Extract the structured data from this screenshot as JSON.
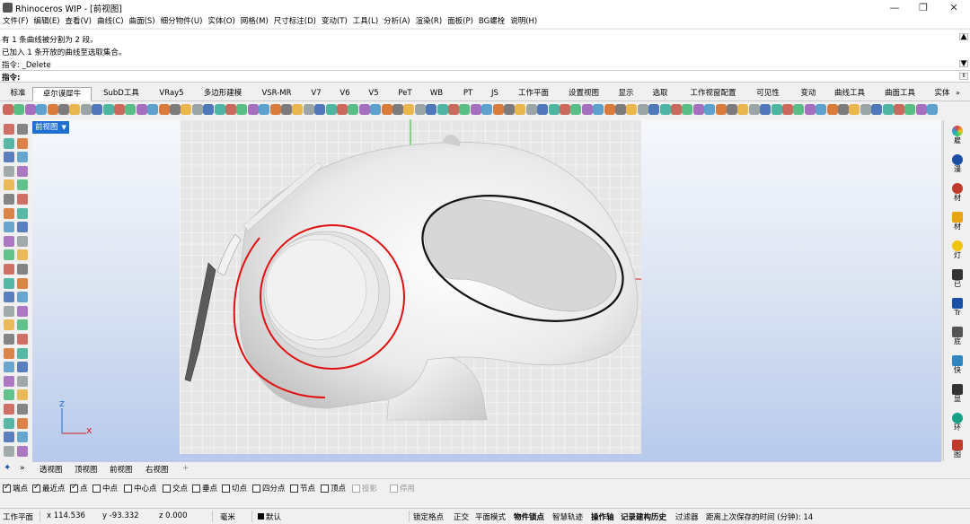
{
  "window": {
    "title": "Rhinoceros WIP - [前视图]",
    "minimize": "—",
    "maximize": "❐",
    "close": "✕"
  },
  "menu": [
    "文件(F)",
    "编辑(E)",
    "查看(V)",
    "曲线(C)",
    "曲面(S)",
    "细分物件(U)",
    "实体(O)",
    "网格(M)",
    "尺寸标注(D)",
    "变动(T)",
    "工具(L)",
    "分析(A)",
    "渲染(R)",
    "面板(P)",
    "BG螺栓",
    "说明(H)"
  ],
  "history": [
    "有 1 条曲线被分割为 2 段。",
    "已加入 1 条开放的曲线至选取集合。",
    "指令: _Delete"
  ],
  "command": {
    "label": "指令:",
    "value": ""
  },
  "tabs": [
    {
      "label": "标准",
      "active": false
    },
    {
      "label": "卓尔谟犀牛",
      "active": true
    },
    {
      "label": "SubD工具",
      "active": false
    },
    {
      "label": "VRay5",
      "active": false
    },
    {
      "label": "多边形建模",
      "active": false
    },
    {
      "label": "VSR-MR",
      "active": false
    },
    {
      "label": "V7",
      "active": false
    },
    {
      "label": "V6",
      "active": false
    },
    {
      "label": "V5",
      "active": false
    },
    {
      "label": "PeT",
      "active": false
    },
    {
      "label": "WB",
      "active": false
    },
    {
      "label": "PT",
      "active": false
    },
    {
      "label": "JS",
      "active": false
    },
    {
      "label": "工作平面",
      "active": false
    },
    {
      "label": "设置视图",
      "active": false
    },
    {
      "label": "显示",
      "active": false
    },
    {
      "label": "选取",
      "active": false
    },
    {
      "label": "工作视窗配置",
      "active": false
    },
    {
      "label": "可见性",
      "active": false
    },
    {
      "label": "变动",
      "active": false
    },
    {
      "label": "曲线工具",
      "active": false
    },
    {
      "label": "曲面工具",
      "active": false
    },
    {
      "label": "实体",
      "active": false
    }
  ],
  "viewport": {
    "name": "前视图",
    "axis_x": "x",
    "axis_z": "z"
  },
  "right_panel": [
    {
      "label": "雇",
      "icon": "color-wheel-icon",
      "color": "#e04040"
    },
    {
      "label": "漫",
      "icon": "sphere-icon",
      "color": "#1a4fa8"
    },
    {
      "label": "材",
      "icon": "brush-icon",
      "color": "#c0392b"
    },
    {
      "label": "材",
      "icon": "folder-icon",
      "color": "#e8a317"
    },
    {
      "label": "灯",
      "icon": "bulb-icon",
      "color": "#f1c40f"
    },
    {
      "label": "已",
      "icon": "camera-icon",
      "color": "#333333"
    },
    {
      "label": "Tr",
      "icon": "text-icon",
      "color": "#1a4fa8"
    },
    {
      "label": "底",
      "icon": "layers-icon",
      "color": "#555555"
    },
    {
      "label": "快",
      "icon": "picture-icon",
      "color": "#2e86c1"
    },
    {
      "label": "显",
      "icon": "monitor-icon",
      "color": "#333333"
    },
    {
      "label": "环",
      "icon": "globe-icon",
      "color": "#16a085"
    },
    {
      "label": "图",
      "icon": "image-icon",
      "color": "#c0392b"
    }
  ],
  "view_tabs": [
    "透视图",
    "顶视图",
    "前视图",
    "右视图"
  ],
  "view_tab_add": "+",
  "osnaps": [
    {
      "label": "端点",
      "checked": true,
      "enabled": true
    },
    {
      "label": "最近点",
      "checked": true,
      "enabled": true
    },
    {
      "label": "点",
      "checked": true,
      "enabled": true
    },
    {
      "label": "中点",
      "checked": false,
      "enabled": true
    },
    {
      "label": "中心点",
      "checked": false,
      "enabled": true
    },
    {
      "label": "交点",
      "checked": false,
      "enabled": true
    },
    {
      "label": "垂点",
      "checked": false,
      "enabled": true
    },
    {
      "label": "切点",
      "checked": false,
      "enabled": true
    },
    {
      "label": "四分点",
      "checked": false,
      "enabled": true
    },
    {
      "label": "节点",
      "checked": false,
      "enabled": true
    },
    {
      "label": "顶点",
      "checked": false,
      "enabled": true
    },
    {
      "label": "投影",
      "checked": false,
      "enabled": false
    },
    {
      "label": "停用",
      "checked": false,
      "enabled": false
    }
  ],
  "status": {
    "cplane": "工作平面",
    "x": "x 114.536",
    "y": "y -93.332",
    "z": "z 0.000",
    "unit": "毫米",
    "layer": "默认",
    "toggles": [
      {
        "label": "锁定格点",
        "bold": false
      },
      {
        "label": "正交",
        "bold": false
      },
      {
        "label": "平面模式",
        "bold": false
      },
      {
        "label": "物件锁点",
        "bold": true
      },
      {
        "label": "智慧轨迹",
        "bold": false
      },
      {
        "label": "操作轴",
        "bold": true
      },
      {
        "label": "记录建构历史",
        "bold": true
      },
      {
        "label": "过滤器",
        "bold": false
      }
    ],
    "autosave": "距离上次保存的时间 (分钟): 14"
  },
  "colors": {
    "accent": "#1f6fd1",
    "curve_red": "#e01010",
    "curve_black": "#111111",
    "axis_green": "#2db62d"
  }
}
